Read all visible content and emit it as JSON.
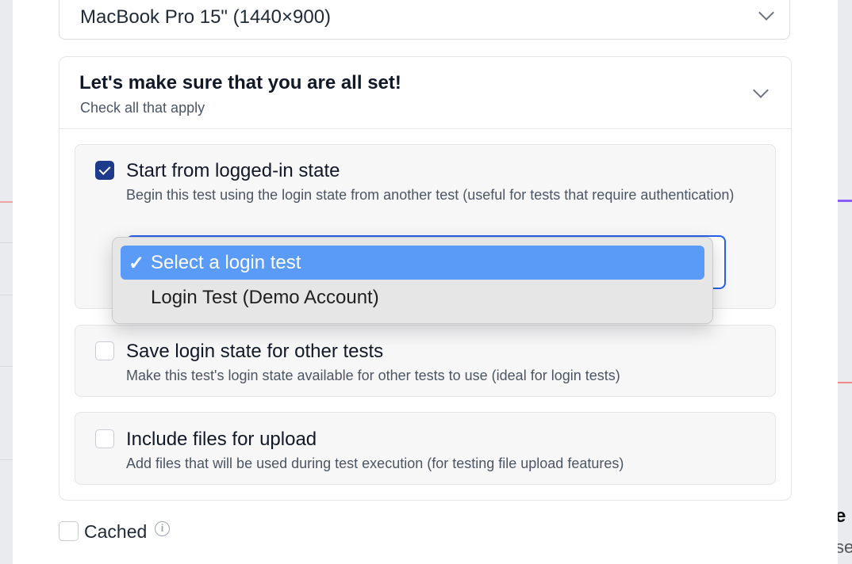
{
  "device": {
    "selected": "MacBook Pro 15\" (1440×900)"
  },
  "setup": {
    "title": "Let's make sure that you are all set!",
    "subtitle": "Check all that apply",
    "options": [
      {
        "label": "Start from logged-in state",
        "description": "Begin this test using the login state from another test (useful for tests that require authentication)",
        "checked": true
      },
      {
        "label": "Save login state for other tests",
        "description": "Make this test's login state available for other tests to use (ideal for login tests)",
        "checked": false
      },
      {
        "label": "Include files for upload",
        "description": "Add files that will be used during test execution (for testing file upload features)",
        "checked": false
      }
    ]
  },
  "login_dropdown": {
    "check_glyph": "✓",
    "options": [
      "Select a login test",
      "Login Test (Demo Account)"
    ],
    "selected_index": 0
  },
  "cached": {
    "label": "Cached",
    "checked": false,
    "info_glyph": "i"
  },
  "background": {
    "heading_fragment": "e",
    "text_fragment": "se"
  },
  "colors": {
    "accent": "#1e3a8a",
    "focus": "#2563eb",
    "dropdown_highlight": "#5b9bf8"
  }
}
